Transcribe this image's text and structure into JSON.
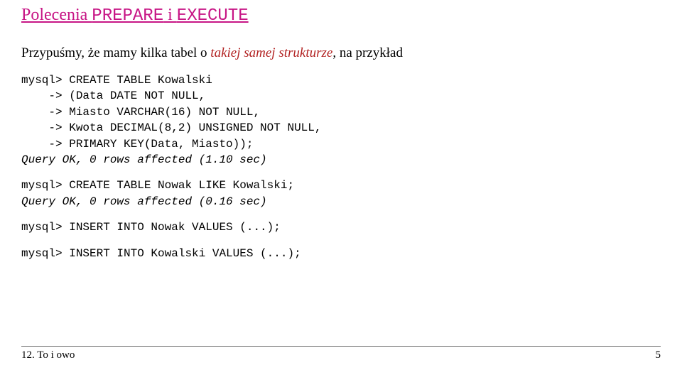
{
  "heading": {
    "part1": "Polecenia ",
    "mono1": "PREPARE",
    "part2": " i ",
    "mono2": "EXECUTE"
  },
  "intro": {
    "part1": "Przypuśmy, że mamy kilka tabel o ",
    "italic": "takiej samej strukturze",
    "part2": ", na przykład"
  },
  "code1": {
    "l1": "mysql> CREATE TABLE Kowalski",
    "l2": "    -> (Data DATE NOT NULL,",
    "l3": "    -> Miasto VARCHAR(16) NOT NULL,",
    "l4": "    -> Kwota DECIMAL(8,2) UNSIGNED NOT NULL,",
    "l5": "    -> PRIMARY KEY(Data, Miasto));",
    "l6": "Query OK, 0 rows affected (1.10 sec)"
  },
  "code2": {
    "l1": "mysql> CREATE TABLE Nowak LIKE Kowalski;",
    "l2": "Query OK, 0 rows affected (0.16 sec)"
  },
  "code3": {
    "l1": "mysql> INSERT INTO Nowak VALUES (...);"
  },
  "code4": {
    "l1": "mysql> INSERT INTO Kowalski VALUES (...);"
  },
  "footer": {
    "left": "12. To i owo",
    "right": "5"
  }
}
